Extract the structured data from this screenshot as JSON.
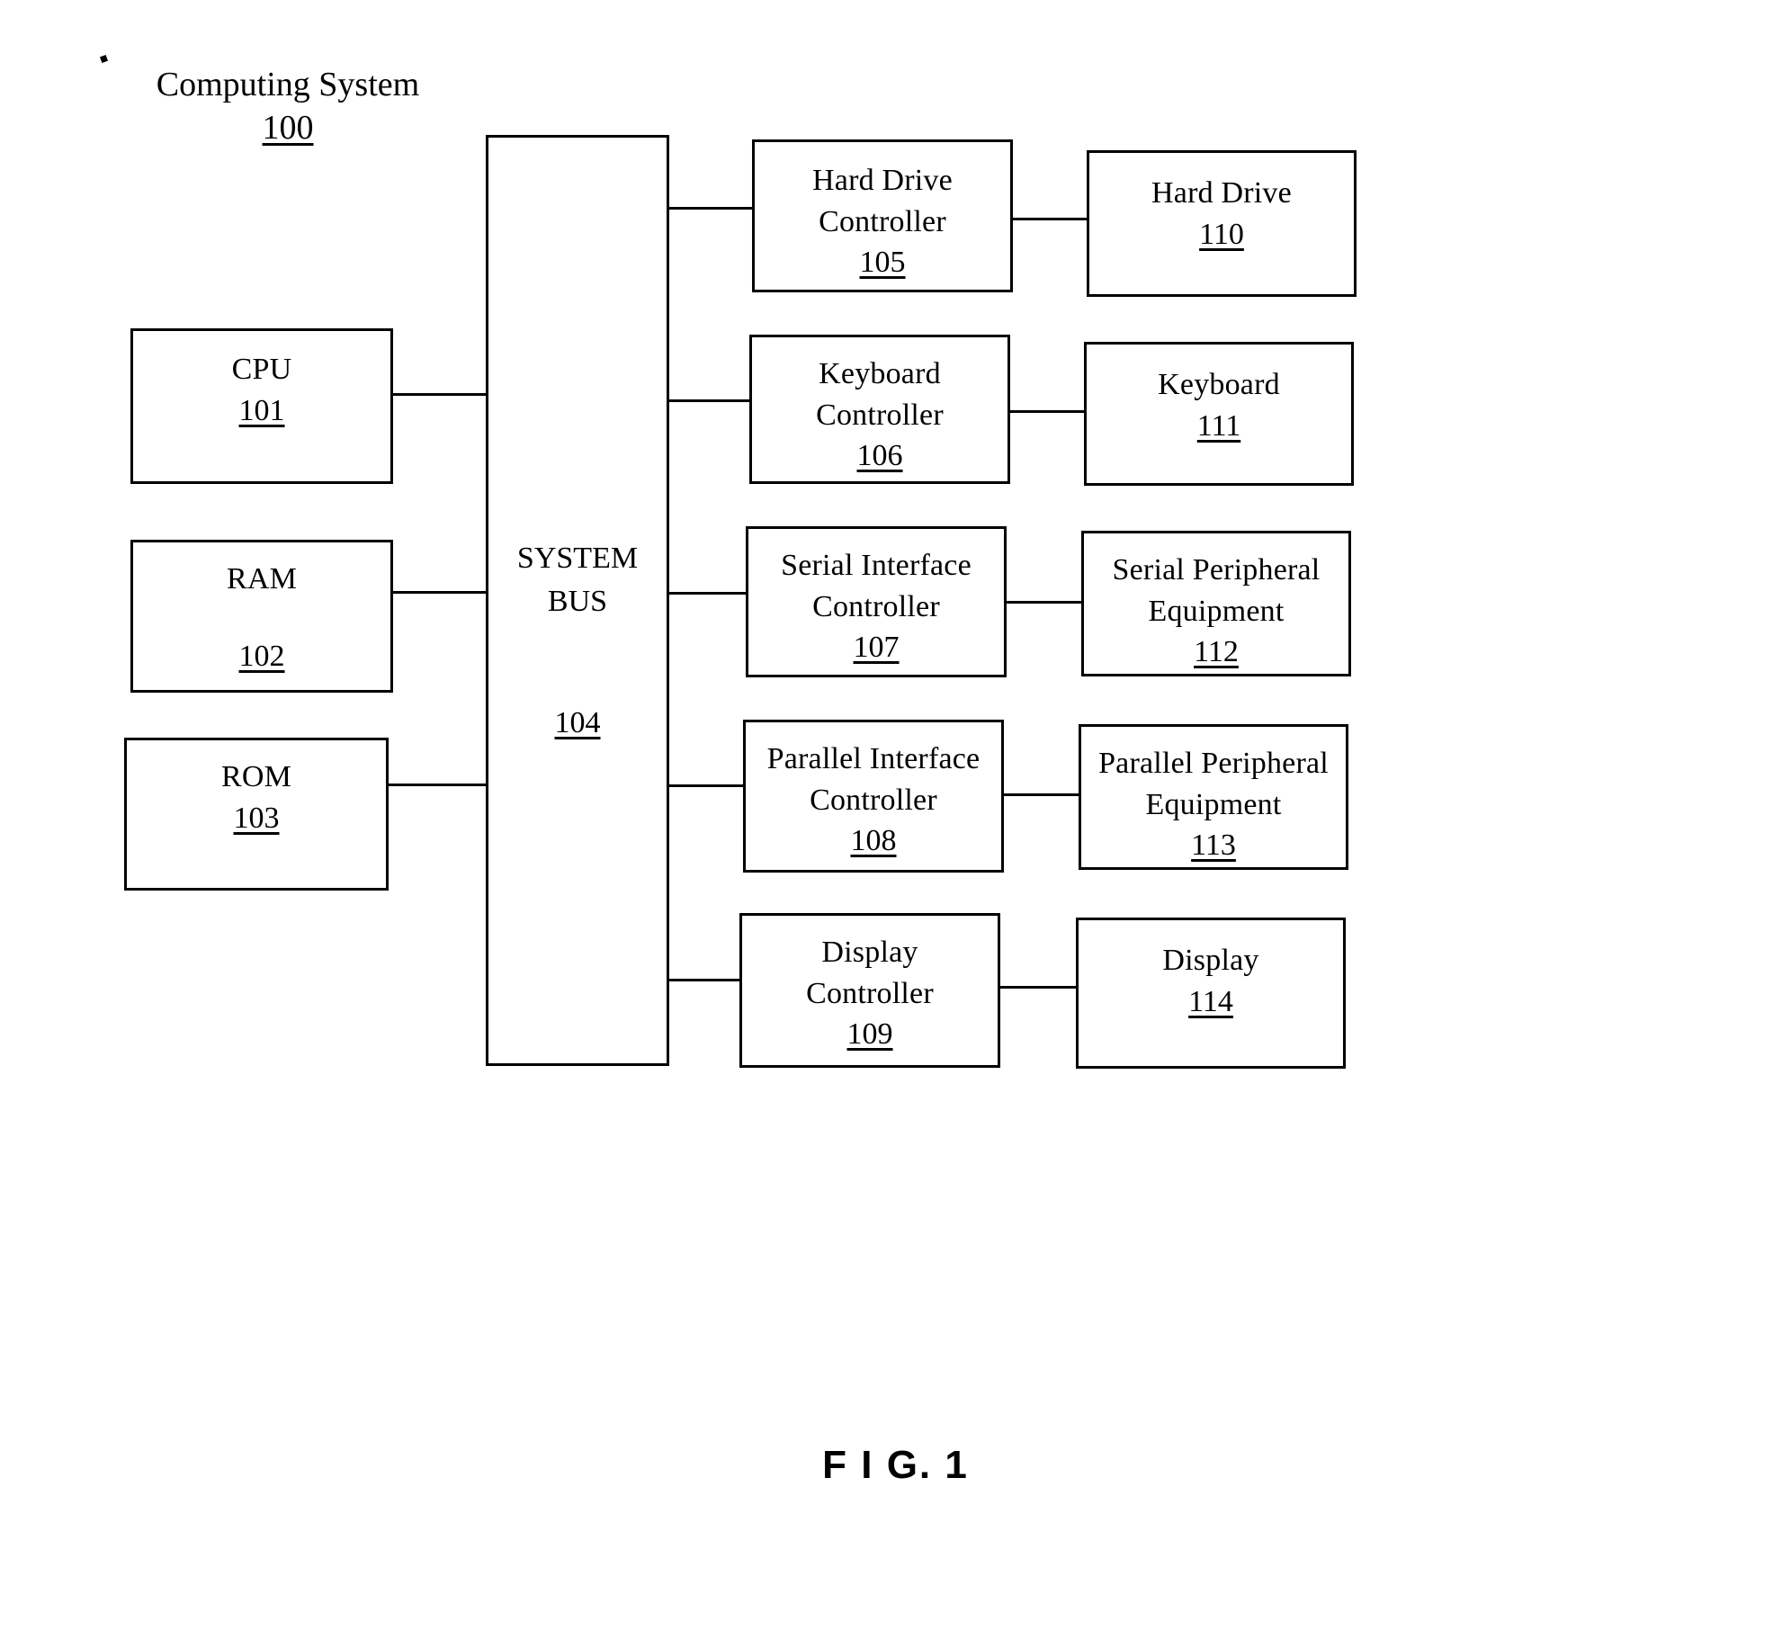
{
  "figure": {
    "title": "Computing System",
    "title_ref": "100",
    "caption": "F I G. 1"
  },
  "bus": {
    "label_line1": "SYSTEM",
    "label_line2": "BUS",
    "ref": "104"
  },
  "left_column": [
    {
      "name": "cpu",
      "lines": [
        "CPU"
      ],
      "ref": "101"
    },
    {
      "name": "ram",
      "lines": [
        "RAM"
      ],
      "ref": "102"
    },
    {
      "name": "rom",
      "lines": [
        "ROM"
      ],
      "ref": "103"
    }
  ],
  "controller_column": [
    {
      "name": "hard-drive-controller",
      "lines": [
        "Hard Drive",
        "Controller"
      ],
      "ref": "105"
    },
    {
      "name": "keyboard-controller",
      "lines": [
        "Keyboard",
        "Controller"
      ],
      "ref": "106"
    },
    {
      "name": "serial-interface-controller",
      "lines": [
        "Serial Interface",
        "Controller"
      ],
      "ref": "107"
    },
    {
      "name": "parallel-interface-controller",
      "lines": [
        "Parallel Interface",
        "Controller"
      ],
      "ref": "108"
    },
    {
      "name": "display-controller",
      "lines": [
        "Display",
        "Controller"
      ],
      "ref": "109"
    }
  ],
  "device_column": [
    {
      "name": "hard-drive",
      "lines": [
        "Hard Drive"
      ],
      "ref": "110"
    },
    {
      "name": "keyboard",
      "lines": [
        "Keyboard"
      ],
      "ref": "111"
    },
    {
      "name": "serial-peripheral-equipment",
      "lines": [
        "Serial Peripheral",
        "Equipment"
      ],
      "ref": "112"
    },
    {
      "name": "parallel-peripheral-equipment",
      "lines": [
        "Parallel Peripheral",
        "Equipment"
      ],
      "ref": "113"
    },
    {
      "name": "display",
      "lines": [
        "Display"
      ],
      "ref": "114"
    }
  ],
  "colors": {
    "ink": "#000000",
    "paper": "#ffffff"
  }
}
